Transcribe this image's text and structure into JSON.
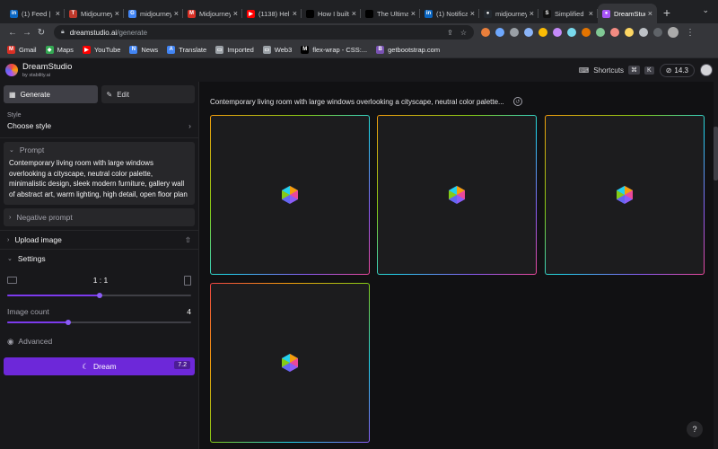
{
  "browser": {
    "tabs": [
      {
        "title": "(1) Feed | LinkedIn",
        "icon": "linkedin-icon",
        "color": "#0a66c2",
        "glyph": "in"
      },
      {
        "title": "Midjourney",
        "icon": "tripadvisor-t-icon",
        "color": "#c0392b",
        "glyph": "T"
      },
      {
        "title": "midjourney - Google",
        "icon": "google-icon",
        "color": "#4285f4",
        "glyph": "G"
      },
      {
        "title": "Midjourney",
        "icon": "gmail-icon",
        "color": "#d93025",
        "glyph": "M"
      },
      {
        "title": "(1138) Hello",
        "icon": "youtube-icon",
        "color": "#ff0000",
        "glyph": "▶"
      },
      {
        "title": "How I built",
        "icon": "dev-icon",
        "color": "#000000",
        "glyph": "DEV"
      },
      {
        "title": "The Ultimate",
        "icon": "dev-icon",
        "color": "#000000",
        "glyph": "DEV"
      },
      {
        "title": "(1) Notifications",
        "icon": "linkedin-icon",
        "color": "#0a66c2",
        "glyph": "in"
      },
      {
        "title": "midjourney",
        "icon": "github-icon",
        "color": "#24292f",
        "glyph": "●"
      },
      {
        "title": "Simplified",
        "icon": "simplified-icon",
        "color": "#111111",
        "glyph": "S"
      },
      {
        "title": "DreamStudio",
        "icon": "dreamstudio-icon",
        "color": "#a855f7",
        "glyph": "●",
        "active": true
      }
    ],
    "new_tab": "+",
    "url_host": "dreamstudio.ai",
    "url_path": "/generate",
    "bookmarks": [
      {
        "label": "Gmail",
        "icon": "gmail-icon",
        "color": "#d93025",
        "glyph": "M"
      },
      {
        "label": "Maps",
        "icon": "maps-icon",
        "color": "#34a853",
        "glyph": "◆"
      },
      {
        "label": "YouTube",
        "icon": "youtube-icon",
        "color": "#ff0000",
        "glyph": "▶"
      },
      {
        "label": "News",
        "icon": "news-icon",
        "color": "#4285f4",
        "glyph": "N"
      },
      {
        "label": "Translate",
        "icon": "translate-icon",
        "color": "#4285f4",
        "glyph": "A"
      },
      {
        "label": "Imported",
        "icon": "folder-icon",
        "color": "#9aa0a6",
        "glyph": "▭"
      },
      {
        "label": "Web3",
        "icon": "folder-icon",
        "color": "#9aa0a6",
        "glyph": "▭"
      },
      {
        "label": "flex-wrap - CSS:...",
        "icon": "mdn-icon",
        "color": "#000000",
        "glyph": "M"
      },
      {
        "label": "getbootstrap.com",
        "icon": "bootstrap-icon",
        "color": "#7952b3",
        "glyph": "B"
      }
    ]
  },
  "app": {
    "name": "DreamStudio",
    "by": "by stability.ai",
    "shortcuts_label": "Shortcuts",
    "shortcut_keys": [
      "⌘",
      "K"
    ],
    "credits": "14.3"
  },
  "sidebar": {
    "generate_label": "Generate",
    "edit_label": "Edit",
    "style_label": "Style",
    "style_value": "Choose style",
    "prompt_label": "Prompt",
    "prompt_text": "Contemporary living room with large windows overlooking a cityscape, neutral color palette, minimalistic design, sleek modern furniture, gallery wall of abstract art, warm lighting, high detail, open floor plan",
    "negative_prompt_label": "Negative prompt",
    "upload_label": "Upload image",
    "settings_label": "Settings",
    "aspect_ratio": "1 : 1",
    "aspect_ratio_level": 0.5,
    "image_count_label": "Image count",
    "image_count": "4",
    "image_count_level": 0.33,
    "advanced_label": "Advanced",
    "dream_label": "Dream",
    "dream_cost": "7.2"
  },
  "main": {
    "prompt_preview": "Contemporary living room with large windows overlooking a cityscape, neutral color palette...",
    "help": "?"
  }
}
